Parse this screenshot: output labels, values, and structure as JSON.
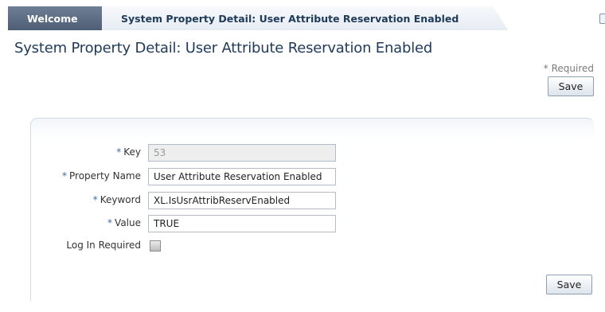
{
  "tabs": [
    {
      "label": "Welcome"
    },
    {
      "label": "System Property Detail: User Attribute Reservation Enabled"
    }
  ],
  "page": {
    "title": "System Property Detail: User Attribute Reservation Enabled",
    "required_note": "* Required",
    "save_label": "Save"
  },
  "form": {
    "required_marker": "*",
    "key": {
      "label": "Key",
      "value": "53"
    },
    "property_name": {
      "label": "Property Name",
      "value": "User Attribute Reservation Enabled"
    },
    "keyword": {
      "label": "Keyword",
      "value": "XL.IsUsrAttribReservEnabled"
    },
    "value": {
      "label": "Value",
      "value": "TRUE"
    },
    "login_required": {
      "label": "Log In Required",
      "checked": false
    }
  },
  "colors": {
    "active_tab": "#4d5e75",
    "title": "#203b5c",
    "required_marker": "#3a6ea5"
  }
}
